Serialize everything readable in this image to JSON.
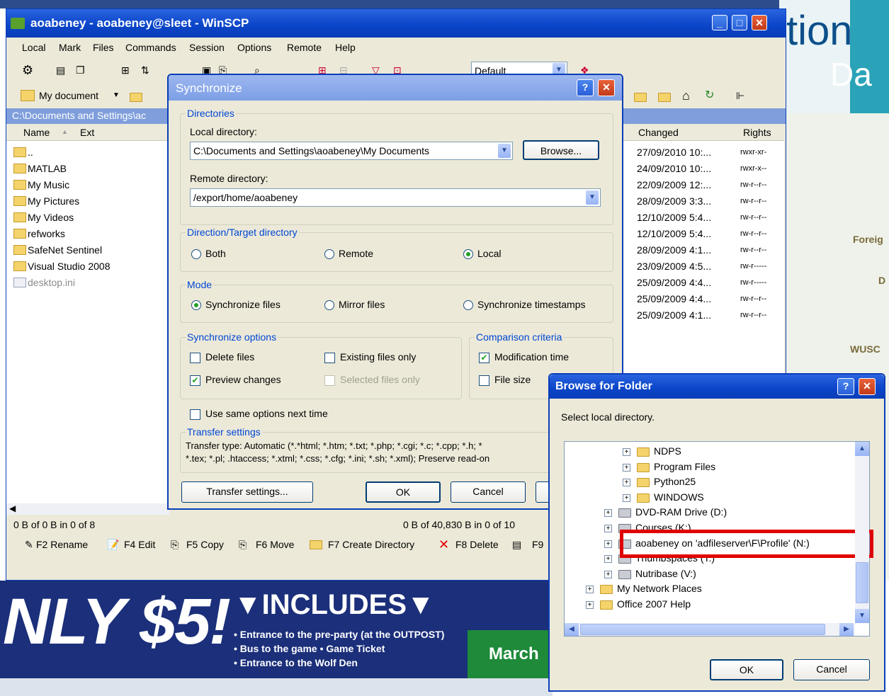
{
  "winscp": {
    "title": "aoabeney - aoabeney@sleet - WinSCP",
    "menu": [
      "Local",
      "Mark",
      "Files",
      "Commands",
      "Session",
      "Options",
      "Remote",
      "Help"
    ],
    "toolbar_default": "Default",
    "left_path_dropdown": "My document",
    "left_path": "C:\\Documents and Settings\\ac",
    "left_columns": [
      "Name",
      "Ext"
    ],
    "left_files": [
      "..",
      "MATLAB",
      "My Music",
      "My Pictures",
      "My Videos",
      "refworks",
      "SafeNet Sentinel",
      "Visual Studio 2008",
      "desktop.ini"
    ],
    "right_columns": [
      "Changed",
      "Rights"
    ],
    "right_rows": [
      {
        "changed": "27/09/2010 10:...",
        "rights": "rwxr-xr-"
      },
      {
        "changed": "24/09/2010 10:...",
        "rights": "rwxr-x--"
      },
      {
        "changed": "22/09/2009 12:...",
        "rights": "rw-r--r--"
      },
      {
        "changed": "28/09/2009 3:3...",
        "rights": "rw-r--r--"
      },
      {
        "changed": "12/10/2009 5:4...",
        "rights": "rw-r--r--"
      },
      {
        "changed": "12/10/2009 5:4...",
        "rights": "rw-r--r--"
      },
      {
        "changed": "28/09/2009 4:1...",
        "rights": "rw-r--r--"
      },
      {
        "changed": "23/09/2009 4:5...",
        "rights": "rw-r-----"
      },
      {
        "changed": "25/09/2009 4:4...",
        "rights": "rw-r-----"
      },
      {
        "changed": "25/09/2009 4:4...",
        "rights": "rw-r--r--"
      },
      {
        "changed": "25/09/2009 4:1...",
        "rights": "rw-r--r--"
      }
    ],
    "status_left": "0 B of 0 B in 0 of 8",
    "status_right": "0 B of 40,830 B in 0 of 10",
    "fkeys": [
      "F2 Rename",
      "F4 Edit",
      "F5 Copy",
      "F6 Move",
      "F7 Create Directory",
      "F8 Delete",
      "F9"
    ]
  },
  "sync": {
    "title": "Synchronize",
    "directories_title": "Directories",
    "local_dir_label": "Local directory:",
    "local_dir_value": "C:\\Documents and Settings\\aoabeney\\My Documents",
    "browse_label": "Browse...",
    "remote_dir_label": "Remote directory:",
    "remote_dir_value": "/export/home/aoabeney",
    "direction_title": "Direction/Target directory",
    "direction_options": [
      "Both",
      "Remote",
      "Local"
    ],
    "direction_selected": "Local",
    "mode_title": "Mode",
    "mode_options": [
      "Synchronize files",
      "Mirror files",
      "Synchronize timestamps"
    ],
    "mode_selected": "Synchronize files",
    "sync_options_title": "Synchronize options",
    "delete_files": "Delete files",
    "existing_files_only": "Existing files only",
    "preview_changes": "Preview changes",
    "selected_files_only": "Selected files only",
    "comparison_title": "Comparison criteria",
    "modification_time": "Modification time",
    "file_size": "File size",
    "use_same_options": "Use same options next time",
    "transfer_title": "Transfer settings",
    "transfer_line1": "Transfer type: Automatic (*.*html; *.htm; *.txt; *.php; *.cgi; *.c; *.cpp; *.h; *",
    "transfer_line2": "*.tex; *.pl; .htaccess; *.xtml; *.css; *.cfg; *.ini; *.sh; *.xml); Preserve read-on",
    "transfer_button": "Transfer settings...",
    "ok": "OK",
    "cancel": "Cancel"
  },
  "browse": {
    "title": "Browse for Folder",
    "prompt": "Select local directory.",
    "tree": [
      {
        "label": "NDPS",
        "indent": 3
      },
      {
        "label": "Program Files",
        "indent": 3
      },
      {
        "label": "Python25",
        "indent": 3
      },
      {
        "label": "WINDOWS",
        "indent": 3
      },
      {
        "label": "DVD-RAM Drive (D:)",
        "indent": 2
      },
      {
        "label": "Courses (K:)",
        "indent": 2
      },
      {
        "label": "aoabeney on 'adfileserver\\F\\Profile' (N:)",
        "indent": 2
      },
      {
        "label": "Thumbspaces (T:)",
        "indent": 2
      },
      {
        "label": "Nutribase (V:)",
        "indent": 2
      },
      {
        "label": "My Network Places",
        "indent": 1
      },
      {
        "label": "Office 2007 Help",
        "indent": 1
      }
    ],
    "ok": "OK",
    "cancel": "Cancel"
  },
  "poster": {
    "top_right_1": "tion",
    "top_right_2": "Da",
    "side_labels": [
      "Foreig",
      "D",
      "WUSC"
    ],
    "big": "NLY $5!",
    "includes": "▼INCLUDES▼",
    "lines": [
      "• Entrance to the pre-party (at the OUTPOST)",
      "• Bus to the game • Game Ticket",
      "• Entrance  to the Wolf Den"
    ],
    "march": "March"
  },
  "colors": {
    "xp_blue": "#0a44c8",
    "dialog_bg": "#ece9d8",
    "highlight_red": "#e00000"
  }
}
